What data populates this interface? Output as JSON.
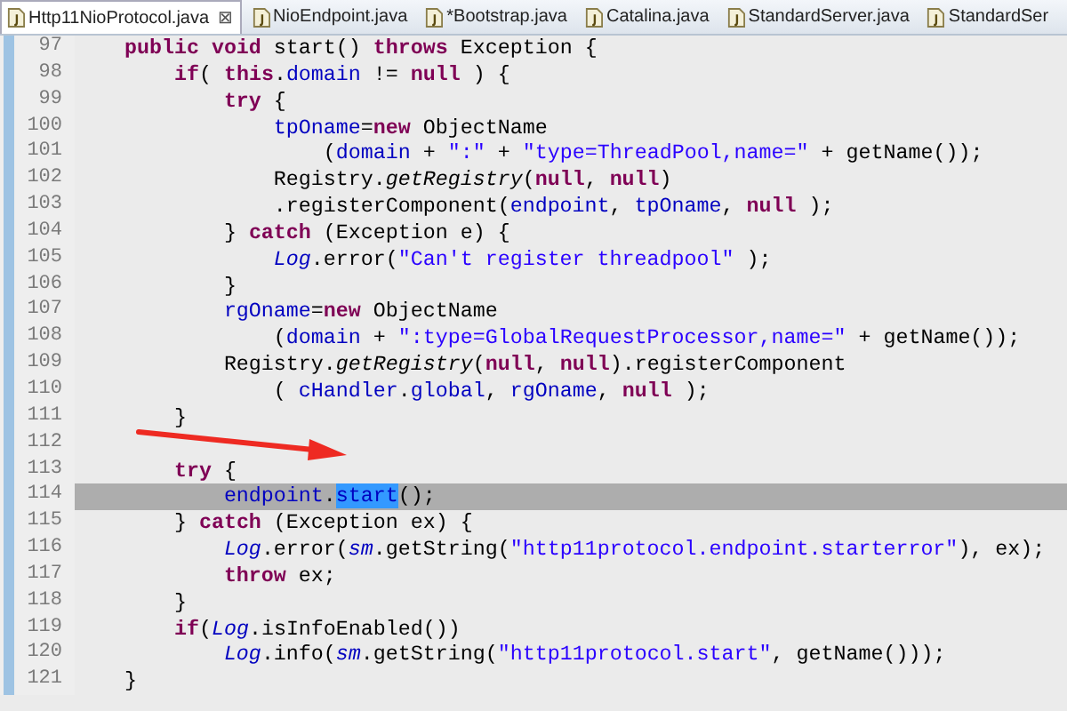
{
  "tabs": [
    {
      "label": "Http11NioProtocol.java",
      "selected": true,
      "close": "⊠"
    },
    {
      "label": "NioEndpoint.java",
      "selected": false
    },
    {
      "label": "*Bootstrap.java",
      "selected": false
    },
    {
      "label": "Catalina.java",
      "selected": false
    },
    {
      "label": "StandardServer.java",
      "selected": false
    },
    {
      "label": "StandardSer",
      "selected": false
    }
  ],
  "editor": {
    "lines": [
      {
        "number": "97",
        "current": false,
        "tokens": [
          {
            "kind": "keyword",
            "text": "    public void"
          },
          {
            "kind": "plain",
            "text": " start() "
          },
          {
            "kind": "keyword",
            "text": "throws"
          },
          {
            "kind": "plain",
            "text": " Exception {"
          }
        ]
      },
      {
        "number": "98",
        "current": false,
        "tokens": [
          {
            "kind": "keyword",
            "text": "        if"
          },
          {
            "kind": "plain",
            "text": "( "
          },
          {
            "kind": "keyword",
            "text": "this"
          },
          {
            "kind": "plain",
            "text": "."
          },
          {
            "kind": "field",
            "text": "domain"
          },
          {
            "kind": "plain",
            "text": " != "
          },
          {
            "kind": "keyword",
            "text": "null"
          },
          {
            "kind": "plain",
            "text": " ) {"
          }
        ]
      },
      {
        "number": "99",
        "current": false,
        "tokens": [
          {
            "kind": "keyword",
            "text": "            try"
          },
          {
            "kind": "plain",
            "text": " {"
          }
        ]
      },
      {
        "number": "100",
        "current": false,
        "tokens": [
          {
            "kind": "field",
            "text": "                tpOname"
          },
          {
            "kind": "plain",
            "text": "="
          },
          {
            "kind": "keyword",
            "text": "new"
          },
          {
            "kind": "plain",
            "text": " ObjectName"
          }
        ]
      },
      {
        "number": "101",
        "current": false,
        "tokens": [
          {
            "kind": "plain",
            "text": "                    ("
          },
          {
            "kind": "field",
            "text": "domain"
          },
          {
            "kind": "plain",
            "text": " + "
          },
          {
            "kind": "string",
            "text": "\":\""
          },
          {
            "kind": "plain",
            "text": " + "
          },
          {
            "kind": "string",
            "text": "\"type=ThreadPool,name=\""
          },
          {
            "kind": "plain",
            "text": " + getName());"
          }
        ]
      },
      {
        "number": "102",
        "current": false,
        "tokens": [
          {
            "kind": "plain",
            "text": "                Registry."
          },
          {
            "kind": "static_method",
            "text": "getRegistry"
          },
          {
            "kind": "plain",
            "text": "("
          },
          {
            "kind": "keyword",
            "text": "null"
          },
          {
            "kind": "plain",
            "text": ", "
          },
          {
            "kind": "keyword",
            "text": "null"
          },
          {
            "kind": "plain",
            "text": ")"
          }
        ]
      },
      {
        "number": "103",
        "current": false,
        "tokens": [
          {
            "kind": "plain",
            "text": "                .registerComponent("
          },
          {
            "kind": "field",
            "text": "endpoint"
          },
          {
            "kind": "plain",
            "text": ", "
          },
          {
            "kind": "field",
            "text": "tpOname"
          },
          {
            "kind": "plain",
            "text": ", "
          },
          {
            "kind": "keyword",
            "text": "null"
          },
          {
            "kind": "plain",
            "text": " );"
          }
        ]
      },
      {
        "number": "104",
        "current": false,
        "tokens": [
          {
            "kind": "plain",
            "text": "            } "
          },
          {
            "kind": "keyword",
            "text": "catch"
          },
          {
            "kind": "plain",
            "text": " (Exception e) {"
          }
        ]
      },
      {
        "number": "105",
        "current": false,
        "tokens": [
          {
            "kind": "static_field",
            "text": "                Log"
          },
          {
            "kind": "plain",
            "text": ".error("
          },
          {
            "kind": "string",
            "text": "\"Can't register threadpool\""
          },
          {
            "kind": "plain",
            "text": " );"
          }
        ]
      },
      {
        "number": "106",
        "current": false,
        "tokens": [
          {
            "kind": "plain",
            "text": "            }"
          }
        ]
      },
      {
        "number": "107",
        "current": false,
        "tokens": [
          {
            "kind": "field",
            "text": "            rgOname"
          },
          {
            "kind": "plain",
            "text": "="
          },
          {
            "kind": "keyword",
            "text": "new"
          },
          {
            "kind": "plain",
            "text": " ObjectName"
          }
        ]
      },
      {
        "number": "108",
        "current": false,
        "tokens": [
          {
            "kind": "plain",
            "text": "                ("
          },
          {
            "kind": "field",
            "text": "domain"
          },
          {
            "kind": "plain",
            "text": " + "
          },
          {
            "kind": "string",
            "text": "\":type=GlobalRequestProcessor,name=\""
          },
          {
            "kind": "plain",
            "text": " + getName());"
          }
        ]
      },
      {
        "number": "109",
        "current": false,
        "tokens": [
          {
            "kind": "plain",
            "text": "            Registry."
          },
          {
            "kind": "static_method",
            "text": "getRegistry"
          },
          {
            "kind": "plain",
            "text": "("
          },
          {
            "kind": "keyword",
            "text": "null"
          },
          {
            "kind": "plain",
            "text": ", "
          },
          {
            "kind": "keyword",
            "text": "null"
          },
          {
            "kind": "plain",
            "text": ").registerComponent"
          }
        ]
      },
      {
        "number": "110",
        "current": false,
        "tokens": [
          {
            "kind": "plain",
            "text": "                ( "
          },
          {
            "kind": "field",
            "text": "cHandler"
          },
          {
            "kind": "plain",
            "text": "."
          },
          {
            "kind": "field",
            "text": "global"
          },
          {
            "kind": "plain",
            "text": ", "
          },
          {
            "kind": "field",
            "text": "rgOname"
          },
          {
            "kind": "plain",
            "text": ", "
          },
          {
            "kind": "keyword",
            "text": "null"
          },
          {
            "kind": "plain",
            "text": " );"
          }
        ]
      },
      {
        "number": "111",
        "current": false,
        "tokens": [
          {
            "kind": "plain",
            "text": "        }"
          }
        ]
      },
      {
        "number": "112",
        "current": false
      },
      {
        "number": "113",
        "current": false,
        "tokens": [
          {
            "kind": "keyword",
            "text": "        try"
          },
          {
            "kind": "plain",
            "text": " {"
          }
        ]
      },
      {
        "number": "114",
        "current": true,
        "tokens": [
          {
            "kind": "field",
            "text": "            endpoint"
          },
          {
            "kind": "plain",
            "text": "."
          },
          {
            "kind": "selection",
            "text": "start"
          },
          {
            "kind": "plain",
            "text": "();"
          }
        ]
      },
      {
        "number": "115",
        "current": false,
        "tokens": [
          {
            "kind": "plain",
            "text": "        } "
          },
          {
            "kind": "keyword",
            "text": "catch"
          },
          {
            "kind": "plain",
            "text": " (Exception ex) {"
          }
        ]
      },
      {
        "number": "116",
        "current": false,
        "tokens": [
          {
            "kind": "static_field",
            "text": "            Log"
          },
          {
            "kind": "plain",
            "text": ".error("
          },
          {
            "kind": "static_field",
            "text": "sm"
          },
          {
            "kind": "plain",
            "text": ".getString("
          },
          {
            "kind": "string",
            "text": "\"http11protocol.endpoint.starterror\""
          },
          {
            "kind": "plain",
            "text": "), ex);"
          }
        ]
      },
      {
        "number": "117",
        "current": false,
        "tokens": [
          {
            "kind": "keyword",
            "text": "            throw"
          },
          {
            "kind": "plain",
            "text": " ex;"
          }
        ]
      },
      {
        "number": "118",
        "current": false,
        "tokens": [
          {
            "kind": "plain",
            "text": "        }"
          }
        ]
      },
      {
        "number": "119",
        "current": false,
        "tokens": [
          {
            "kind": "keyword",
            "text": "        if"
          },
          {
            "kind": "plain",
            "text": "("
          },
          {
            "kind": "static_field",
            "text": "Log"
          },
          {
            "kind": "plain",
            "text": ".isInfoEnabled())"
          }
        ]
      },
      {
        "number": "120",
        "current": false,
        "tokens": [
          {
            "kind": "static_field",
            "text": "            Log"
          },
          {
            "kind": "plain",
            "text": ".info("
          },
          {
            "kind": "static_field",
            "text": "sm"
          },
          {
            "kind": "plain",
            "text": ".getString("
          },
          {
            "kind": "string",
            "text": "\"http11protocol.start\""
          },
          {
            "kind": "plain",
            "text": ", getName()));"
          }
        ]
      },
      {
        "number": "121",
        "current": false,
        "tokens": [
          {
            "kind": "plain",
            "text": "    }"
          }
        ]
      }
    ]
  }
}
